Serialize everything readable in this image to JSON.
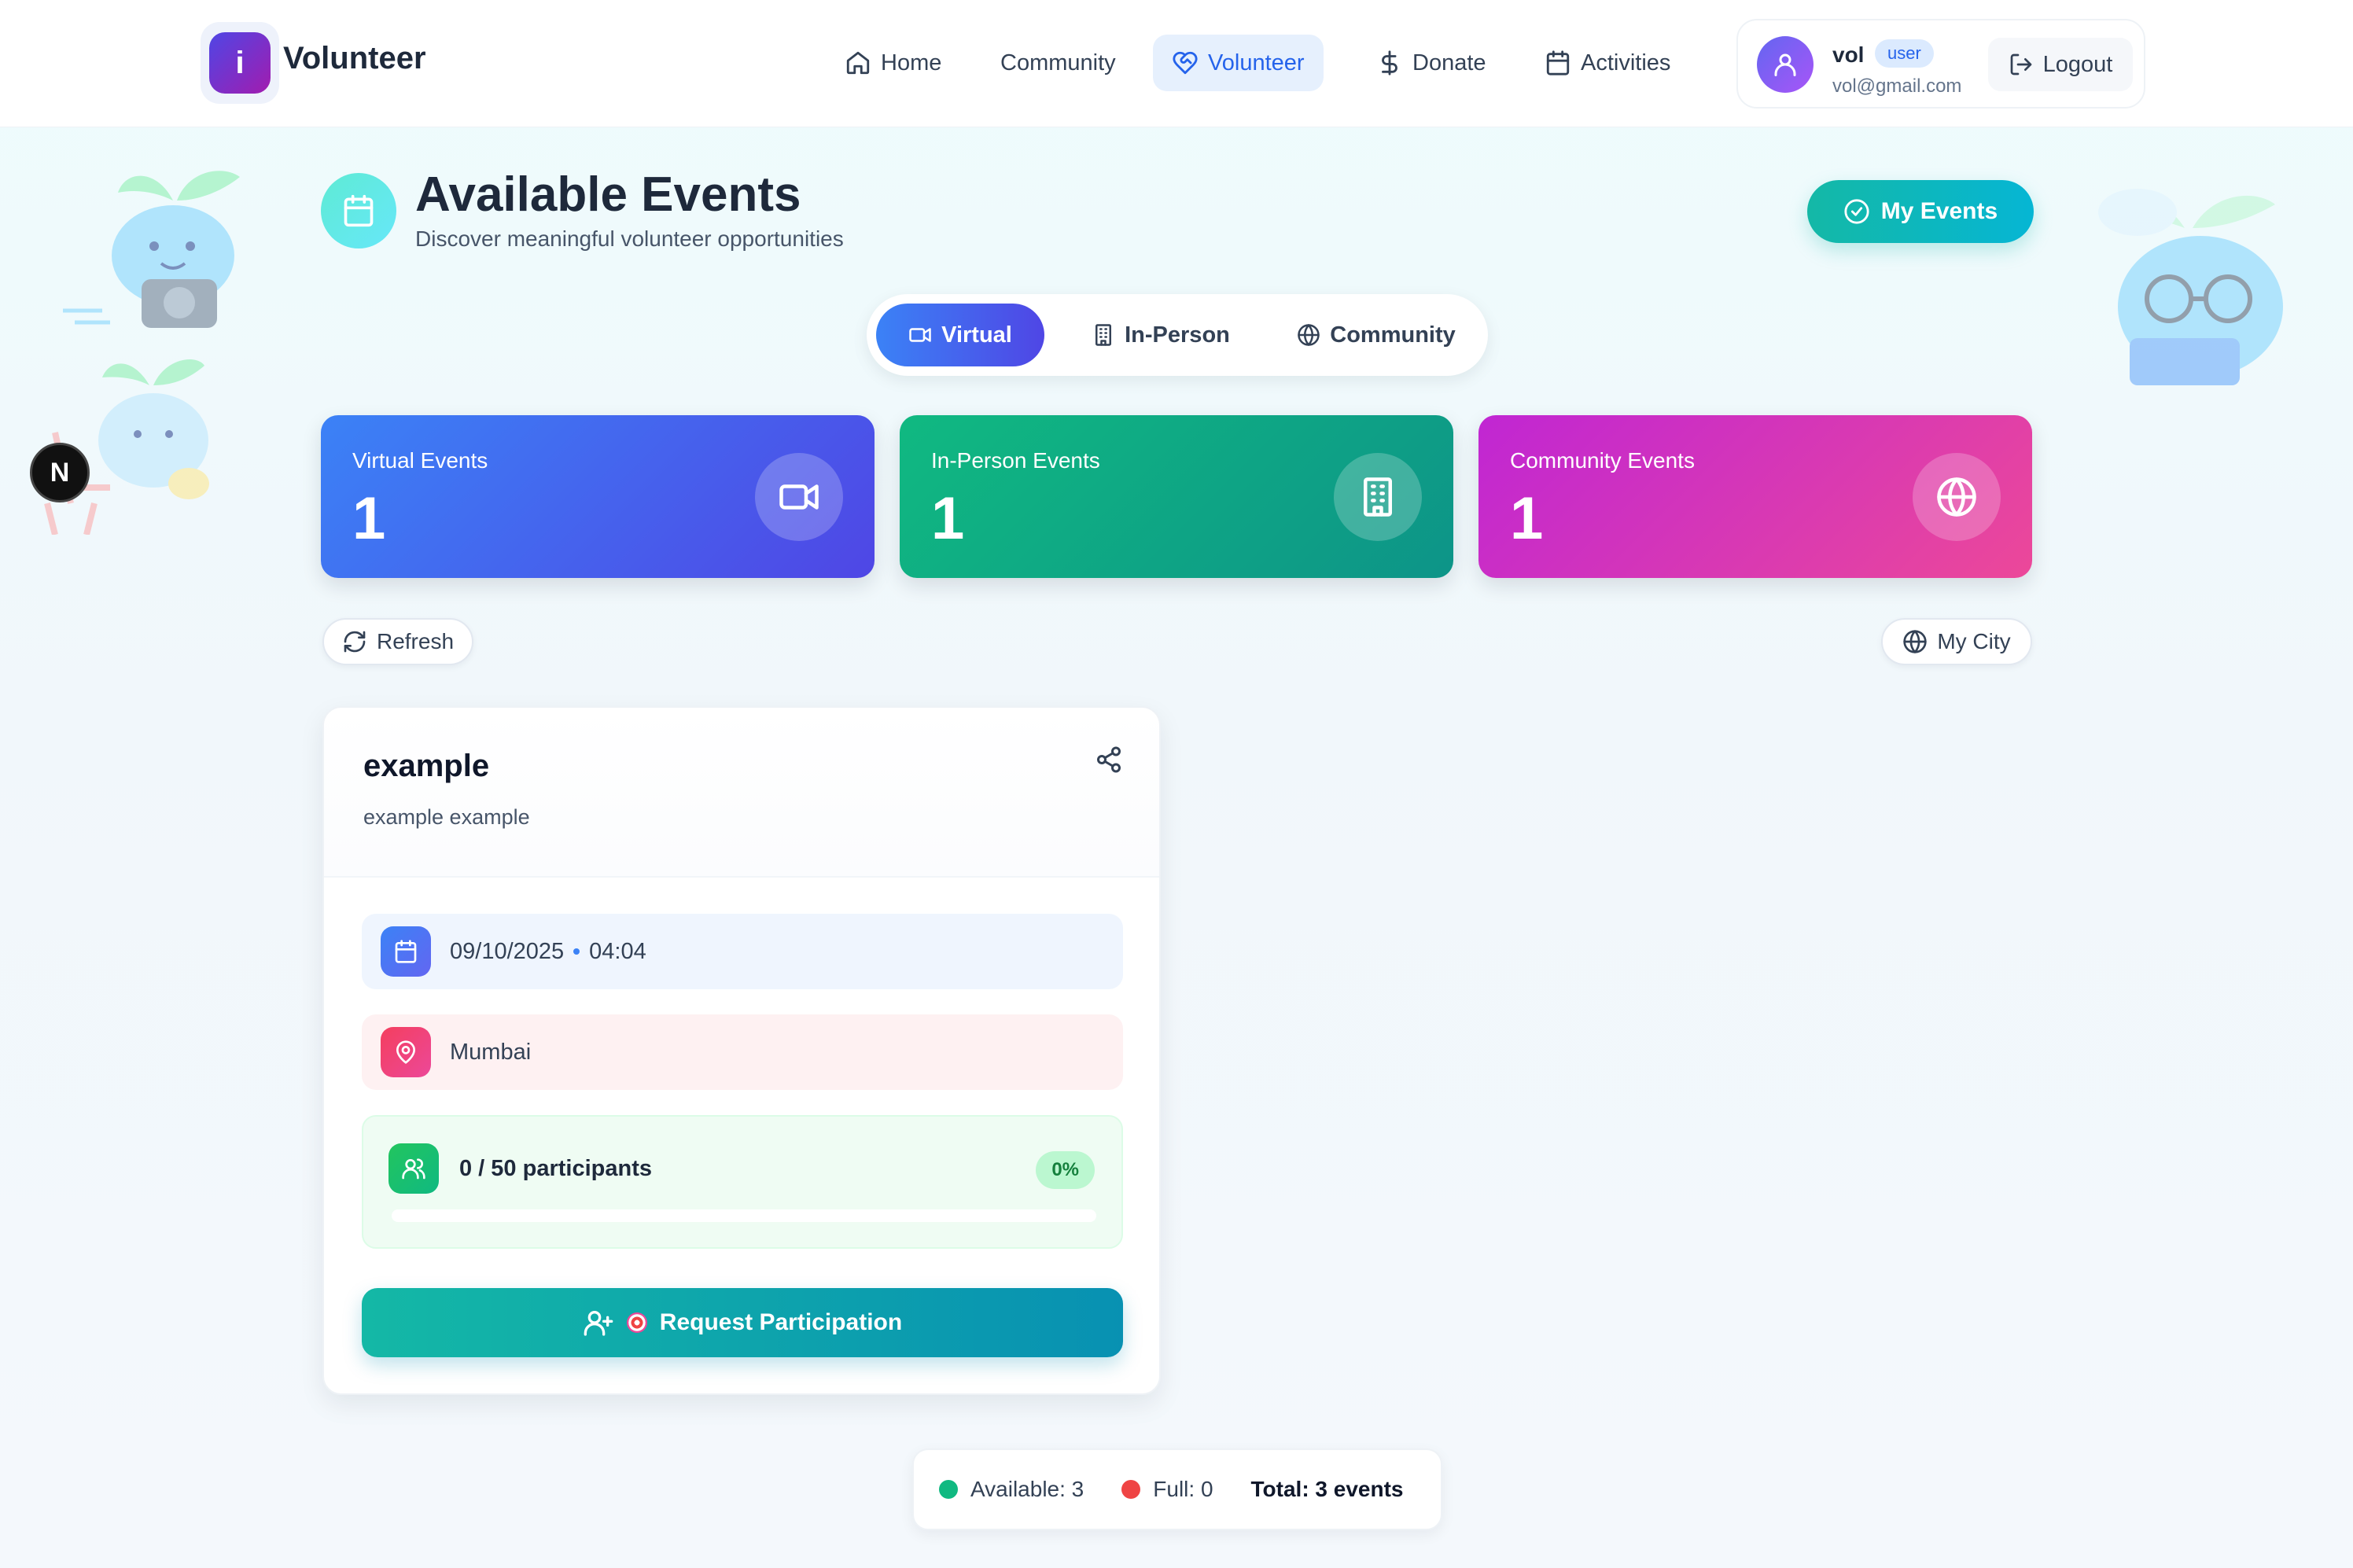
{
  "header": {
    "logo_letter": "i",
    "brand": "Volunteer",
    "nav": [
      {
        "label": "Home",
        "icon": "home-icon"
      },
      {
        "label": "Community",
        "icon": ""
      },
      {
        "label": "Volunteer",
        "icon": "heart-handshake-icon",
        "active": true
      },
      {
        "label": "Donate",
        "icon": "dollar-icon"
      },
      {
        "label": "Activities",
        "icon": "calendar-icon"
      }
    ],
    "user": {
      "name": "vol",
      "role": "user",
      "email": "vol@gmail.com",
      "logout_label": "Logout"
    }
  },
  "dev_badge": "N",
  "page": {
    "title": "Available Events",
    "subtitle": "Discover meaningful volunteer opportunities",
    "my_events_label": "My Events"
  },
  "tabs": [
    {
      "label": "Virtual",
      "icon": "video-icon",
      "active": true
    },
    {
      "label": "In-Person",
      "icon": "building-icon",
      "active": false
    },
    {
      "label": "Community",
      "icon": "globe-icon",
      "active": false
    }
  ],
  "stats": [
    {
      "label": "Virtual Events",
      "value": "1",
      "icon": "video-icon",
      "color_from": "#3b82f6",
      "color_to": "#4f46e5"
    },
    {
      "label": "In-Person Events",
      "value": "1",
      "icon": "building-icon",
      "color_from": "#10b981",
      "color_to": "#0d9488"
    },
    {
      "label": "Community Events",
      "value": "1",
      "icon": "globe-icon",
      "color_from": "#c026d3",
      "color_to": "#ec4899"
    }
  ],
  "controls": {
    "refresh_label": "Refresh",
    "city_label": "My City"
  },
  "event": {
    "title": "example",
    "description": "example example",
    "date": "09/10/2025",
    "time": "04:04",
    "location": "Mumbai",
    "participants_text": "0 / 50 participants",
    "participants_percent": "0%",
    "participants_fill": 0,
    "request_label": "Request Participation"
  },
  "summary": {
    "available": "Available: 3",
    "full": "Full: 0",
    "total": "Total: 3 events",
    "available_color": "#10b981",
    "full_color": "#ef4444"
  }
}
